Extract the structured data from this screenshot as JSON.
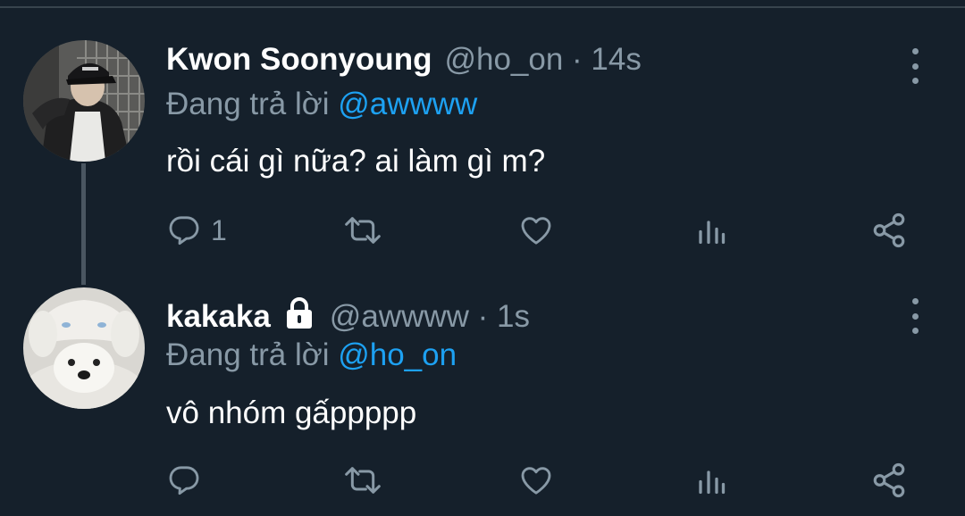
{
  "tweets": [
    {
      "name": "Kwon Soonyoung",
      "handle": "@ho_on · 14s",
      "reply_prefix": "Đang trả lời",
      "reply_mention": "@awwww",
      "text": "rồi cái gì nữa? ai làm gì m?",
      "reply_count": "1",
      "locked": false
    },
    {
      "name": "kakaka",
      "handle": "@awwww · 1s",
      "reply_prefix": "Đang trả lời",
      "reply_mention": "@ho_on",
      "text": "vô nhóm gấppppp",
      "reply_count": "",
      "locked": true
    }
  ],
  "icons": {
    "reply": "reply-icon",
    "retweet": "retweet-icon",
    "like": "heart-icon",
    "analytics": "analytics-icon",
    "share": "share-icon",
    "more": "more-vertical-icon",
    "lock": "lock-icon"
  },
  "colors": {
    "background": "#15202b",
    "text": "#ffffff",
    "secondary": "#8899a6",
    "mention": "#1da1f2"
  }
}
